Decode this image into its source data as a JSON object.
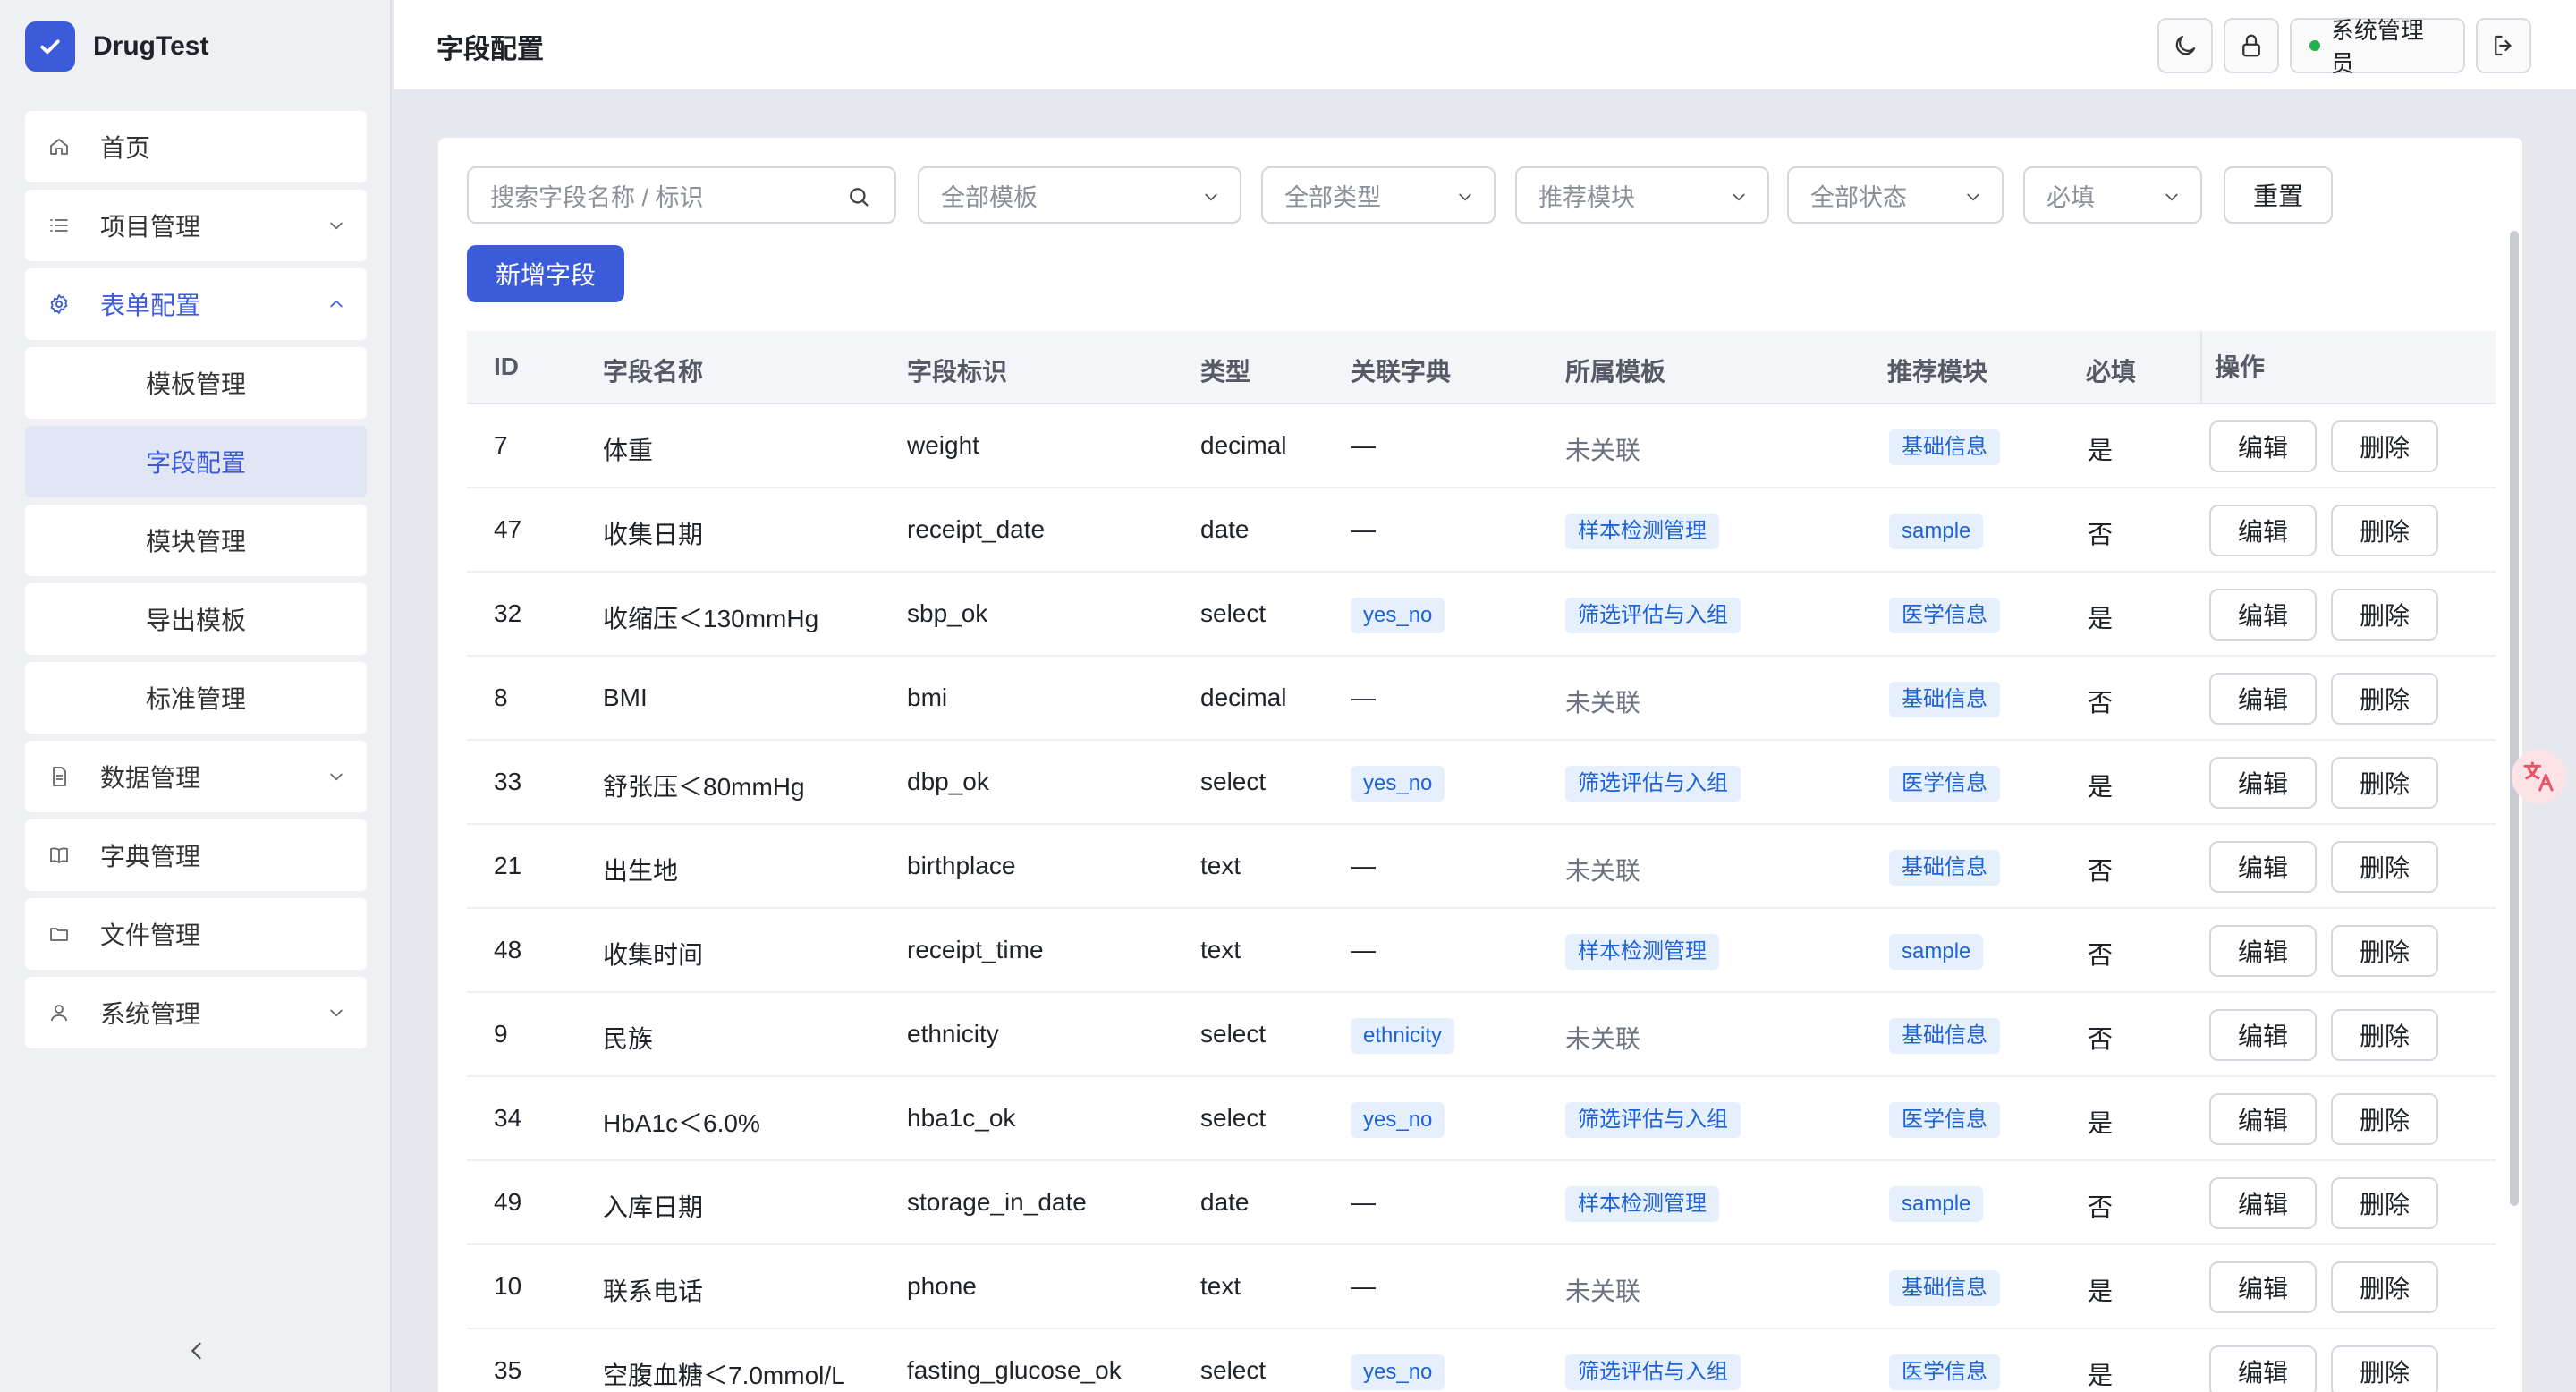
{
  "app": {
    "name": "DrugTest",
    "accent": "#3b5bdb"
  },
  "sidebar": {
    "items": [
      {
        "label": "首页",
        "icon": "home-icon"
      },
      {
        "label": "项目管理",
        "icon": "list-icon"
      },
      {
        "label": "表单配置",
        "icon": "gear-icon"
      }
    ],
    "sub_items": [
      {
        "label": "模板管理"
      },
      {
        "label": "字段配置"
      },
      {
        "label": "模块管理"
      },
      {
        "label": "导出模板"
      },
      {
        "label": "标准管理"
      }
    ],
    "items_after": [
      {
        "label": "数据管理",
        "icon": "file-icon"
      },
      {
        "label": "字典管理",
        "icon": "book-icon"
      },
      {
        "label": "文件管理",
        "icon": "folder-icon"
      },
      {
        "label": "系统管理",
        "icon": "user-icon"
      }
    ]
  },
  "header": {
    "title": "字段配置",
    "user_label": "系统管理员"
  },
  "filters": {
    "search_placeholder": "搜索字段名称 / 标识",
    "template": "全部模板",
    "type": "全部类型",
    "module": "推荐模块",
    "status": "全部状态",
    "required": "必填",
    "reset_label": "重置",
    "add_label": "新增字段"
  },
  "table": {
    "columns": [
      "ID",
      "字段名称",
      "字段标识",
      "类型",
      "关联字典",
      "所属模板",
      "推荐模块",
      "必填",
      "操作"
    ],
    "edit_label": "编辑",
    "delete_label": "删除",
    "rows": [
      {
        "id": "7",
        "name": "体重",
        "key": "weight",
        "type": "decimal",
        "dict": "—",
        "template": "未关联",
        "module": "基础信息",
        "required": "是"
      },
      {
        "id": "47",
        "name": "收集日期",
        "key": "receipt_date",
        "type": "date",
        "dict": "—",
        "template": "样本检测管理",
        "module": "sample",
        "required": "否"
      },
      {
        "id": "32",
        "name": "收缩压＜130mmHg",
        "key": "sbp_ok",
        "type": "select",
        "dict": "yes_no",
        "template": "筛选评估与入组",
        "module": "医学信息",
        "required": "是"
      },
      {
        "id": "8",
        "name": "BMI",
        "key": "bmi",
        "type": "decimal",
        "dict": "—",
        "template": "未关联",
        "module": "基础信息",
        "required": "否"
      },
      {
        "id": "33",
        "name": "舒张压＜80mmHg",
        "key": "dbp_ok",
        "type": "select",
        "dict": "yes_no",
        "template": "筛选评估与入组",
        "module": "医学信息",
        "required": "是"
      },
      {
        "id": "21",
        "name": "出生地",
        "key": "birthplace",
        "type": "text",
        "dict": "—",
        "template": "未关联",
        "module": "基础信息",
        "required": "否"
      },
      {
        "id": "48",
        "name": "收集时间",
        "key": "receipt_time",
        "type": "text",
        "dict": "—",
        "template": "样本检测管理",
        "module": "sample",
        "required": "否"
      },
      {
        "id": "9",
        "name": "民族",
        "key": "ethnicity",
        "type": "select",
        "dict": "ethnicity",
        "template": "未关联",
        "module": "基础信息",
        "required": "否"
      },
      {
        "id": "34",
        "name": "HbA1c＜6.0%",
        "key": "hba1c_ok",
        "type": "select",
        "dict": "yes_no",
        "template": "筛选评估与入组",
        "module": "医学信息",
        "required": "是"
      },
      {
        "id": "49",
        "name": "入库日期",
        "key": "storage_in_date",
        "type": "date",
        "dict": "—",
        "template": "样本检测管理",
        "module": "sample",
        "required": "否"
      },
      {
        "id": "10",
        "name": "联系电话",
        "key": "phone",
        "type": "text",
        "dict": "—",
        "template": "未关联",
        "module": "基础信息",
        "required": "是"
      },
      {
        "id": "35",
        "name": "空腹血糖＜7.0mmol/L",
        "key": "fasting_glucose_ok",
        "type": "select",
        "dict": "yes_no",
        "template": "筛选评估与入组",
        "module": "医学信息",
        "required": "是"
      }
    ]
  }
}
